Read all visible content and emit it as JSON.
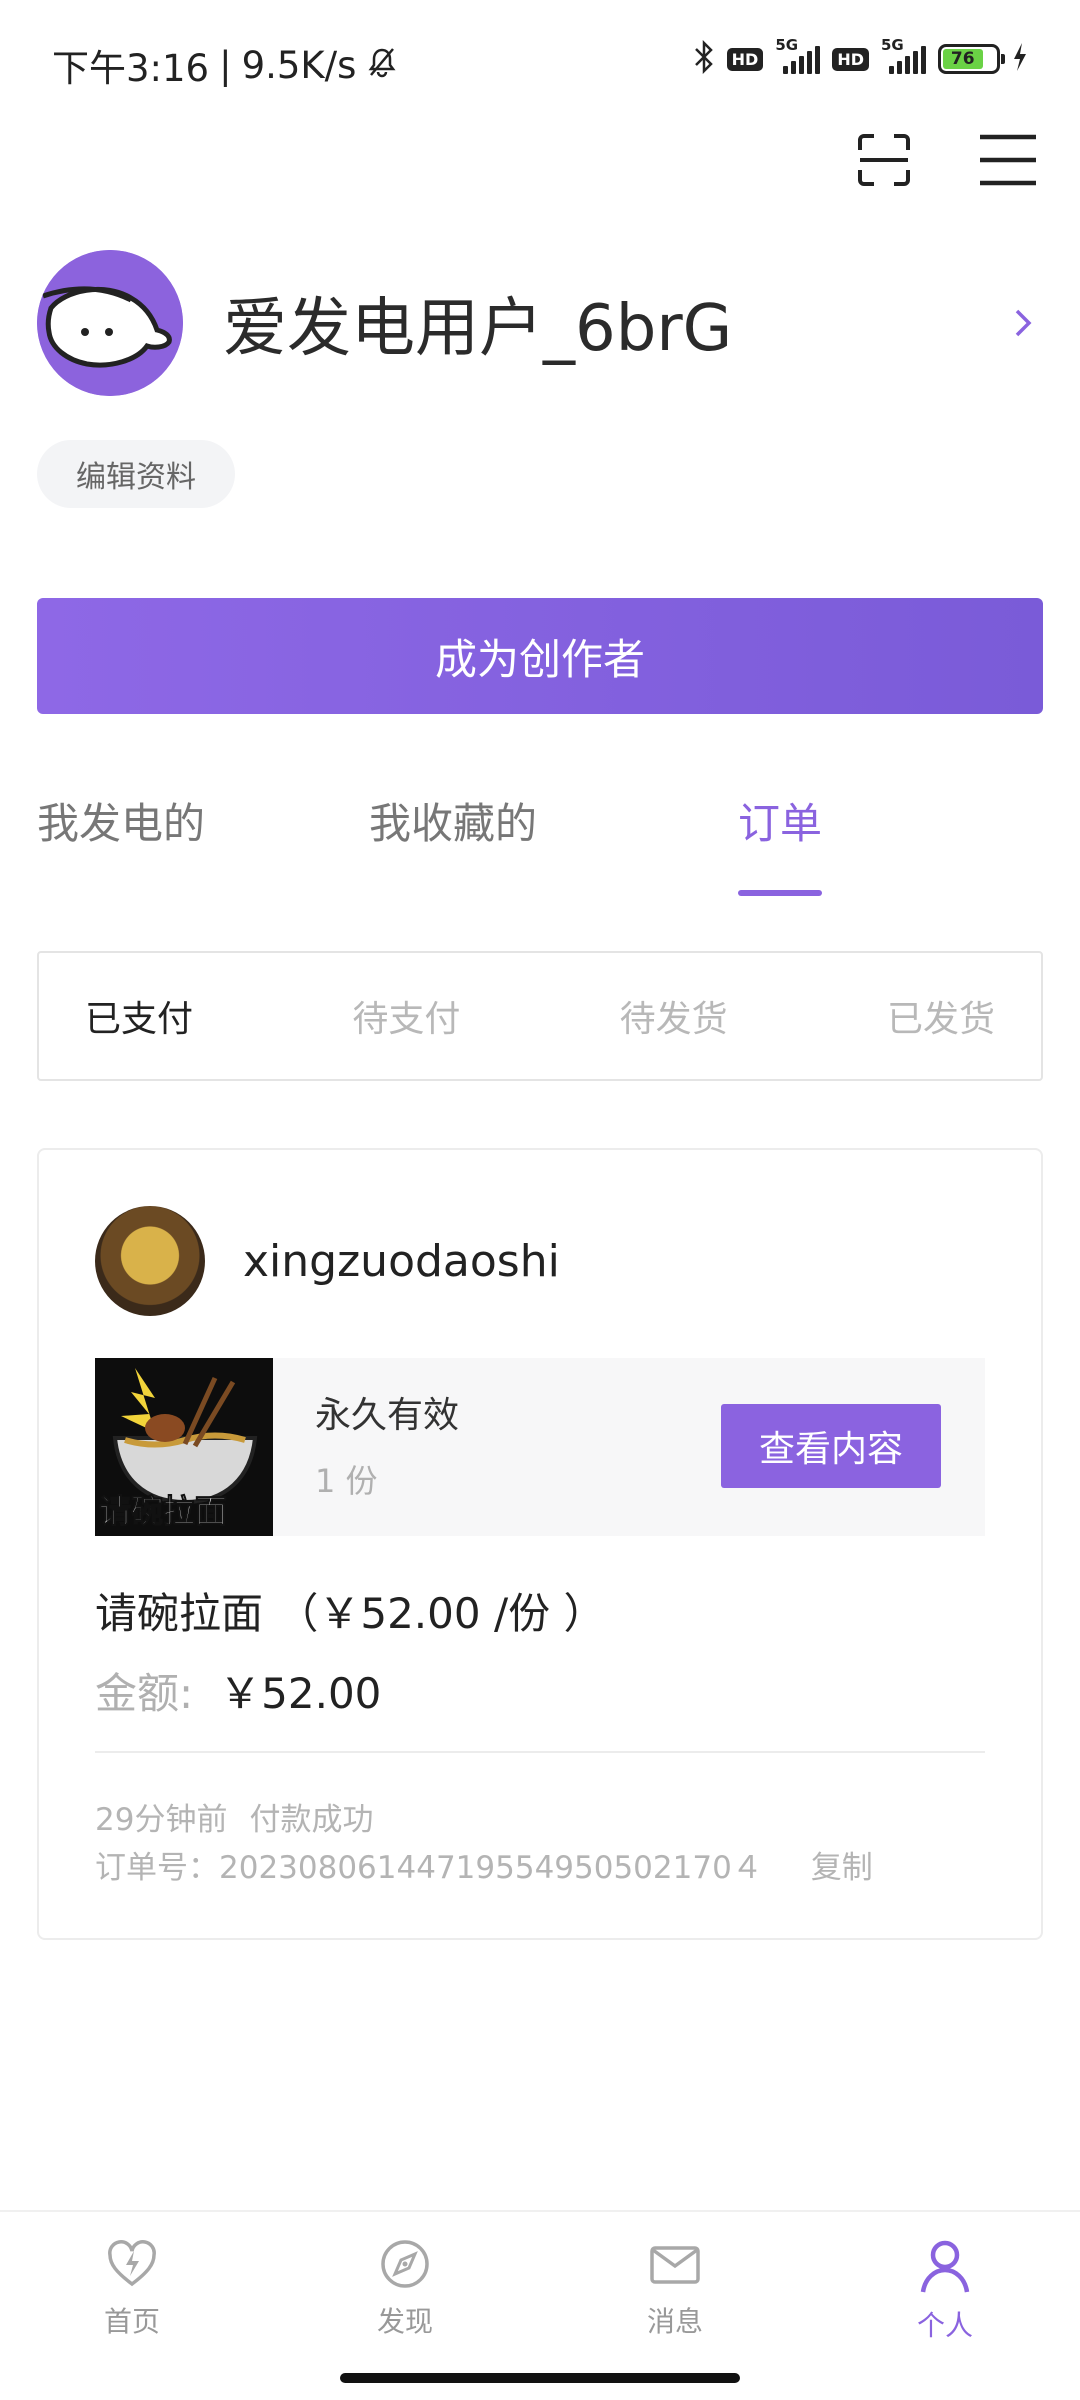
{
  "status_bar": {
    "time": "下午3:16",
    "speed": "9.5K/s",
    "hd1": "HD",
    "hd2": "HD",
    "net1": "5G",
    "net2": "5G",
    "battery": "76"
  },
  "profile": {
    "username": "爱发电用户_6brG",
    "edit_label": "编辑资料"
  },
  "creator_button": "成为创作者",
  "tabs": [
    "我发电的",
    "我收藏的",
    "订单"
  ],
  "order_filters": [
    "已支付",
    "待支付",
    "待发货",
    "已发货"
  ],
  "order": {
    "seller": "xingzuodaoshi",
    "thumb_text": "请碗拉面",
    "validity": "永久有效",
    "quantity": "1 份",
    "view_button": "查看内容",
    "title": "请碗拉面 （￥52.00 /份 ）",
    "amount_label": "金额:",
    "amount_value": "￥52.00",
    "time_ago": "29分钟前",
    "status": "付款成功",
    "order_no": "订单号：20230806144719554950502170４",
    "copy_label": "复制"
  },
  "bottom_nav": [
    {
      "label": "首页",
      "icon": "home-lightning-heart-icon"
    },
    {
      "label": "发现",
      "icon": "discover-icon"
    },
    {
      "label": "消息",
      "icon": "mail-icon"
    },
    {
      "label": "个人",
      "icon": "person-icon"
    }
  ],
  "colors": {
    "accent": "#8a63df",
    "battery": "#6ad245"
  }
}
